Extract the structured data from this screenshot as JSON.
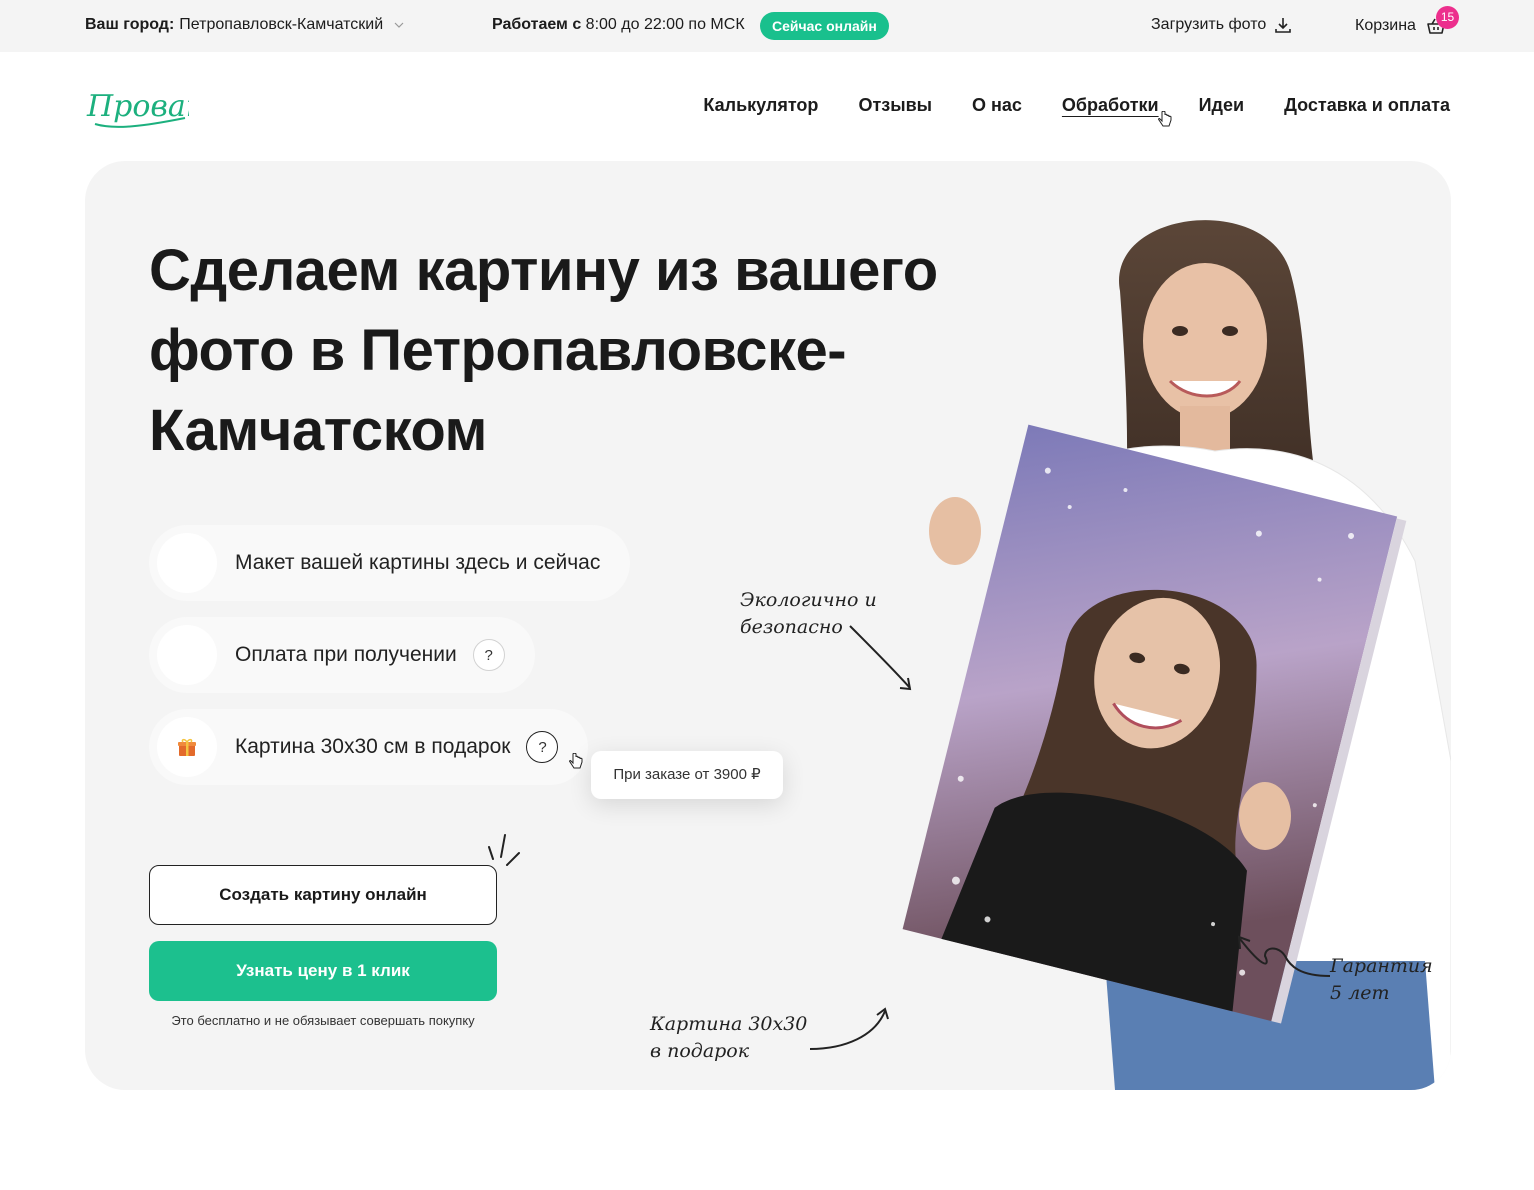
{
  "topbar": {
    "city_label": "Ваш город:",
    "city_value": "Петропавловск-Камчатский",
    "hours_label": "Работаем с",
    "hours_value": "8:00 до 22:00 по МСК",
    "online_badge": "Сейчас онлайн",
    "upload_label": "Загрузить фото",
    "cart_label": "Корзина",
    "cart_count": "15"
  },
  "header": {
    "logo_text": "Прованс",
    "nav": [
      "Калькулятор",
      "Отзывы",
      "О нас",
      "Обработки",
      "Идеи",
      "Доставка и оплата"
    ]
  },
  "hero": {
    "title_lines": [
      "Сделаем картину из вашего",
      "фото в Петропавловске-",
      "Камчатском"
    ],
    "features": [
      {
        "text": "Макет вашей картины здесь и сейчас"
      },
      {
        "text": "Оплата при получении",
        "help": "?"
      },
      {
        "text": "Картина 30x30 см в подарок",
        "help": "?",
        "icon": "gift-icon"
      }
    ],
    "tooltip": "При заказе от 3900 ₽",
    "btn_create": "Создать картину онлайн",
    "btn_price": "Узнать цену в 1 клик",
    "note": "Это бесплатно и не обязывает совершать покупку",
    "annotations": {
      "eco": [
        "Экологично и",
        "безопасно"
      ],
      "gift": [
        "Картина 30х30",
        "в подарок"
      ],
      "warranty": [
        "Гарантия",
        "5 лет"
      ]
    }
  },
  "colors": {
    "accent": "#1cc08e",
    "badge": "#ec2f8d",
    "card": "#f4f4f4"
  }
}
